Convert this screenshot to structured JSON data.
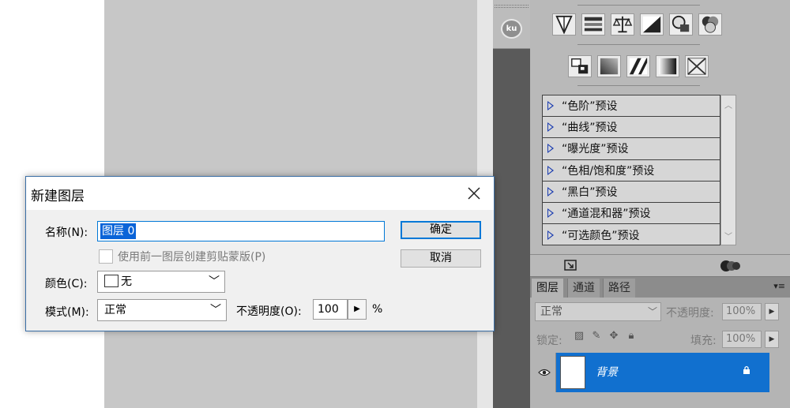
{
  "dialog": {
    "title": "新建图层",
    "name_label": "名称(N):",
    "name_value": "图层 0",
    "ok_label": "确定",
    "cancel_label": "取消",
    "clip_checkbox_label": "使用前一图层创建剪贴蒙版(P)",
    "color_label": "颜色(C):",
    "color_value": "无",
    "mode_label": "模式(M):",
    "mode_value": "正常",
    "opacity_label": "不透明度(O):",
    "opacity_value": "100",
    "opacity_unit": "%"
  },
  "dock": {
    "badge": "ku"
  },
  "adjustments": {
    "presets": [
      "“色阶”预设",
      "“曲线”预设",
      "“曝光度”预设",
      "“色相/饱和度”预设",
      "“黑白”预设",
      "“通道混和器”预设",
      "“可选颜色”预设"
    ]
  },
  "layers_panel": {
    "tabs": [
      "图层",
      "通道",
      "路径"
    ],
    "blend_mode": "正常",
    "opacity_label": "不透明度:",
    "opacity_value": "100%",
    "lock_label": "锁定:",
    "fill_label": "填充:",
    "fill_value": "100%",
    "layer_name": "背景",
    "menu_glyph": "▾≡"
  },
  "colors": {
    "selection_blue": "#1170cf",
    "dialog_focus": "#0078d7",
    "canvas_gray": "#c7c7c7"
  }
}
